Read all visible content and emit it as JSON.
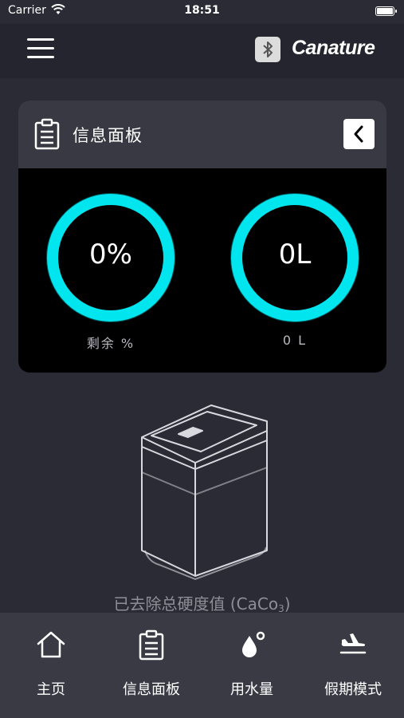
{
  "status_bar": {
    "carrier": "Carrier",
    "time": "18:51"
  },
  "header": {
    "brand": "Canature"
  },
  "panel": {
    "title": "信息面板",
    "gauges": [
      {
        "value": "0%",
        "label": "剩余 %",
        "level": 0
      },
      {
        "value": "0L",
        "label": "0 L",
        "level": 0
      }
    ]
  },
  "device": {
    "hardness_label": "已去除总硬度值 (CaCo",
    "hardness_subscript": "3",
    "hardness_suffix": ")"
  },
  "tab_bar": {
    "items": [
      {
        "label": "主页",
        "icon": "home-icon"
      },
      {
        "label": "信息面板",
        "icon": "clipboard-icon"
      },
      {
        "label": "用水量",
        "icon": "water-drop-icon"
      },
      {
        "label": "假期模式",
        "icon": "airplane-landing-icon"
      }
    ]
  },
  "colors": {
    "accent": "#00e5ee",
    "background": "#2b2b36",
    "navbar": "#25252f",
    "panel_header": "#393943",
    "tab_bar": "#3a3a45"
  }
}
